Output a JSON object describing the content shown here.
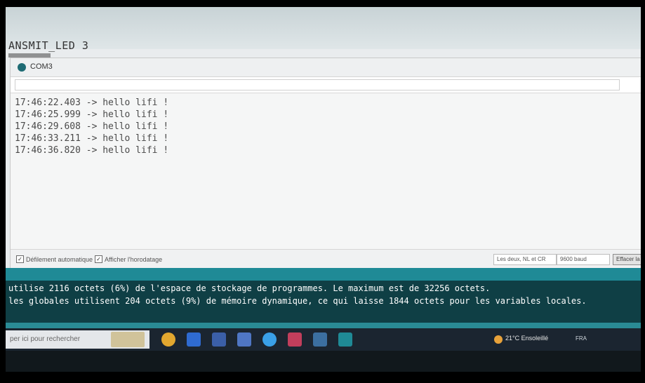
{
  "sketch": {
    "title": "ANSMIT_LED 3"
  },
  "serial_monitor": {
    "port": "COM3",
    "lines": [
      "17:46:22.403 -> hello lifi !",
      "17:46:25.999 -> hello lifi !",
      "17:46:29.608 -> hello lifi !",
      "17:46:33.211 -> hello lifi !",
      "17:46:36.820 -> hello lifi !"
    ],
    "autoscroll_label": "Défilement automatique",
    "timestamp_label": "Afficher l'horodatage",
    "line_ending": "Les deux, NL et CR",
    "baud": "9600 baud",
    "clear_label": "Effacer la sortie"
  },
  "console": {
    "lines": [
      "utilise 2116 octets (6%) de l'espace de stockage de programmes. Le maximum est de 32256 octets.",
      "les globales utilisent 204 octets (9%) de mémoire dynamique, ce qui laisse 1844 octets pour les variables locales."
    ]
  },
  "taskbar": {
    "search_placeholder": "per ici pour rechercher",
    "weather": "21°C Ensoleillé",
    "tray": "FRA"
  },
  "colors": {
    "console_bg": "#0f3f45",
    "console_accent": "#1f8a96",
    "taskbar_bg": "#1b2530"
  }
}
